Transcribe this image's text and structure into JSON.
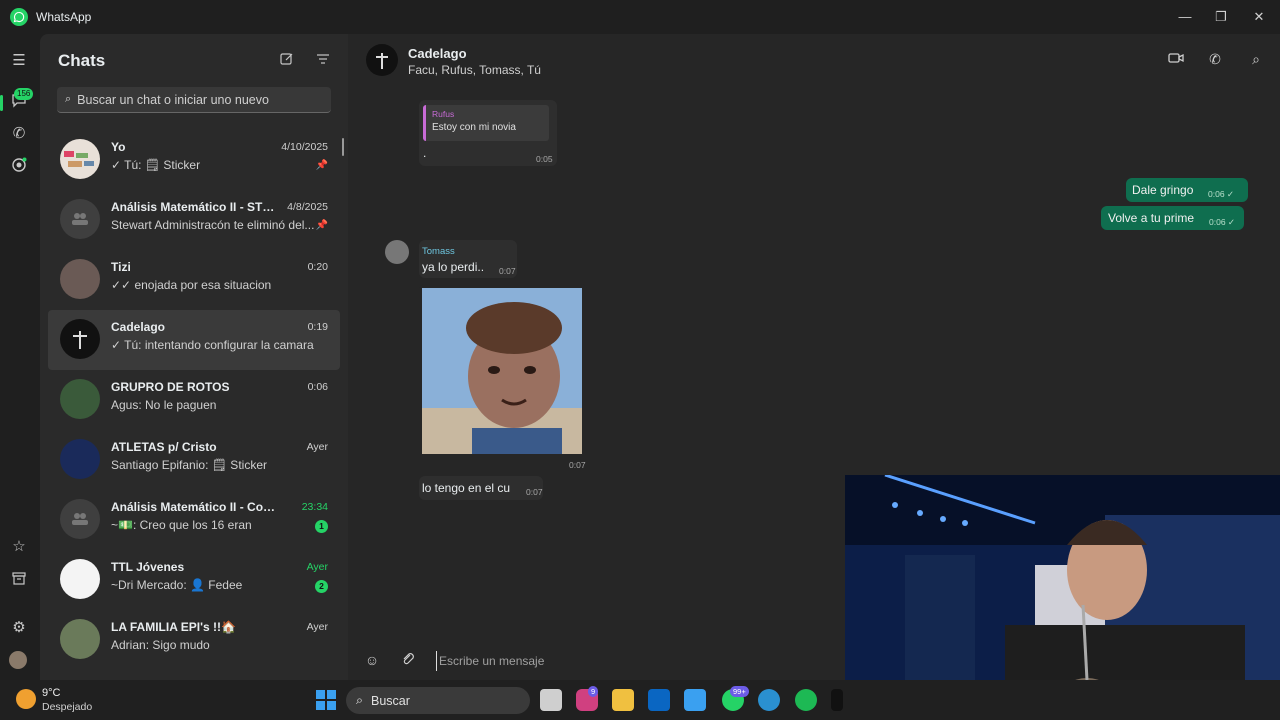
{
  "app": {
    "title": "WhatsApp"
  },
  "window_controls": {
    "minimize": "—",
    "maximize": "❐",
    "close": "✕"
  },
  "rail": {
    "chats_badge": "156"
  },
  "sidebar": {
    "title": "Chats",
    "search_placeholder": "Buscar un chat o iniciar uno nuevo",
    "chats": [
      {
        "name": "Yo",
        "time": "4/10/2025",
        "preview": "✓ Tú: 🗒 Sticker",
        "pinned": true
      },
      {
        "name": "Análisis Matemático II - STE...",
        "time": "4/8/2025",
        "preview": "Stewart Administracón te eliminó del...",
        "pinned": true
      },
      {
        "name": "Tizi",
        "time": "0:20",
        "preview": "✓✓ enojada por esa situacion"
      },
      {
        "name": "Cadelago",
        "time": "0:19",
        "preview": "✓ Tú: intentando configurar la camara",
        "selected": true
      },
      {
        "name": "GRUPRO DE ROTOS",
        "time": "0:06",
        "preview": "Agus: No le paguen"
      },
      {
        "name": "ATLETAS p/ Cristo",
        "time": "Ayer",
        "preview": "Santiago Epifanio: 🗒 Sticker"
      },
      {
        "name": "Análisis Matemático II - Comisi...",
        "time": "23:34",
        "preview": "~💵: Creo que los 16 eran",
        "unread": "1"
      },
      {
        "name": "TTL Jóvenes",
        "time": "Ayer",
        "preview": "~Dri Mercado: 👤 Fedee",
        "unread": "2"
      },
      {
        "name": "LA FAMILIA EPI's !!🏠",
        "time": "Ayer",
        "preview": "Adrian: Sigo mudo"
      }
    ]
  },
  "conversation": {
    "name": "Cadelago",
    "members": "Facu, Rufus, Tomass, Tú",
    "quoted_reply": {
      "author": "Rufus",
      "text": "Estoy con mi novia",
      "body": ".",
      "time": "0:05"
    },
    "outgoing": [
      {
        "text": "Dale gringo",
        "time": "0:06 ✓"
      },
      {
        "text": "Volve a tu prime",
        "time": "0:06 ✓"
      }
    ],
    "incoming_sender": "Tomass",
    "incoming": [
      {
        "text": "ya lo perdi..",
        "time": "0:07"
      },
      {
        "text": "",
        "time": "0:07"
      },
      {
        "text": "lo tengo en el cu",
        "time": "0:07"
      }
    ]
  },
  "composer": {
    "placeholder": "Escribe un mensaje"
  },
  "taskbar": {
    "weather_temp": "9°C",
    "weather_desc": "Despejado",
    "search_label": "Buscar",
    "instagram_badge": "9",
    "whatsapp_badge": "99+"
  }
}
